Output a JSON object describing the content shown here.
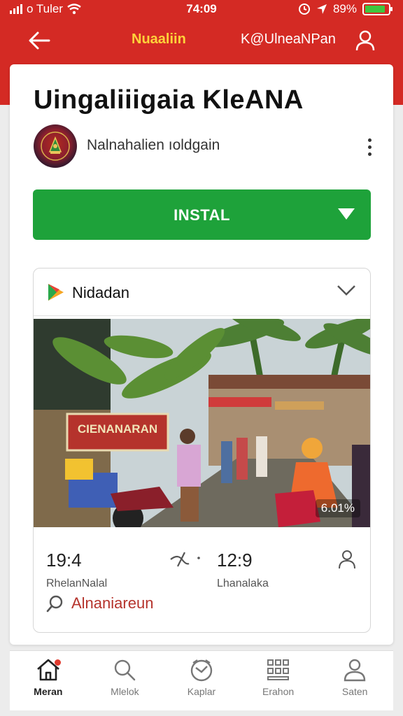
{
  "status_bar": {
    "carrier": "o Tuler",
    "time": "74:09",
    "battery": "89%",
    "battery_level": 0.89
  },
  "top_bar": {
    "title": "Nuaaliin",
    "account": "K@UlneaNPan"
  },
  "app": {
    "title": "Uingaliiigaia KleANA",
    "developer": "Nalnahalien ıoldgain",
    "install_label": "INSTAL"
  },
  "content_card": {
    "source_name": "Nidadan",
    "photo_sign": "CIENANARAN",
    "photo_badge": "6.01%",
    "stats": [
      {
        "value": "19:4",
        "label": "RhelanNalal"
      },
      {
        "value": "12:9",
        "label": "Lhanalaka"
      }
    ],
    "search_text": "Alnaniareun"
  },
  "bottom_nav": {
    "items": [
      {
        "label": "Meran",
        "icon": "home-icon",
        "active": true
      },
      {
        "label": "Mlelok",
        "icon": "search-icon",
        "active": false
      },
      {
        "label": "Kaplar",
        "icon": "clock-icon",
        "active": false
      },
      {
        "label": "Erahon",
        "icon": "grid-icon",
        "active": false
      },
      {
        "label": "Saten",
        "icon": "person-icon",
        "active": false
      }
    ]
  },
  "colors": {
    "header": "#d42a24",
    "title_accent": "#ffd23a",
    "install": "#1ea23a",
    "search_text": "#b5332c",
    "battery_fill": "#3ec73e"
  }
}
